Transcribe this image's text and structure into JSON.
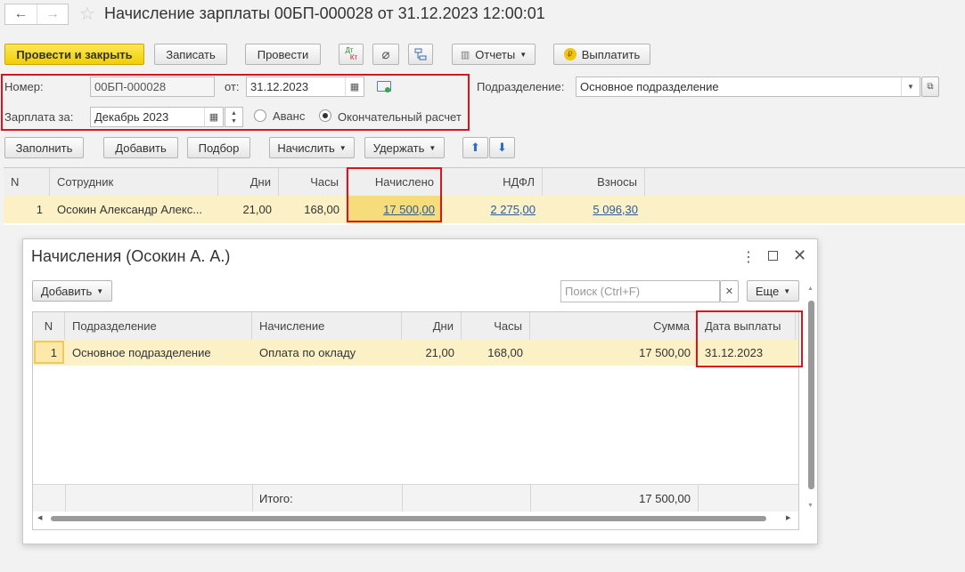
{
  "title": "Начисление зарплаты 00БП-000028 от 31.12.2023 12:00:01",
  "toolbar": {
    "post_close": "Провести и закрыть",
    "save": "Записать",
    "post": "Провести",
    "dtkt_top": "Дт",
    "dtkt_bottom": "Кт",
    "reports": "Отчеты",
    "pay": "Выплатить"
  },
  "header": {
    "number_label": "Номер:",
    "number_value": "00БП-000028",
    "date_label": "от:",
    "date_value": "31.12.2023",
    "dept_label": "Подразделение:",
    "dept_value": "Основное подразделение",
    "salary_label": "Зарплата за:",
    "salary_value": "Декабрь 2023",
    "radio_advance": "Аванс",
    "radio_final": "Окончательный расчет",
    "selected_radio": "final"
  },
  "actions": {
    "fill": "Заполнить",
    "add": "Добавить",
    "select": "Подбор",
    "accrue": "Начислить",
    "withhold": "Удержать"
  },
  "main_table": {
    "columns": [
      "N",
      "Сотрудник",
      "Дни",
      "Часы",
      "Начислено",
      "НДФЛ",
      "Взносы"
    ],
    "rows": [
      {
        "n": "1",
        "employee": "Осокин Александр Алекс...",
        "days": "21,00",
        "hours": "168,00",
        "accrued": "17 500,00",
        "ndfl": "2 275,00",
        "contrib": "5 096,30"
      }
    ]
  },
  "dialog": {
    "title": "Начисления (Осокин А. А.)",
    "add_label": "Добавить",
    "search_placeholder": "Поиск (Ctrl+F)",
    "more_label": "Еще",
    "columns": [
      "N",
      "Подразделение",
      "Начисление",
      "Дни",
      "Часы",
      "Сумма",
      "Дата выплаты"
    ],
    "rows": [
      {
        "n": "1",
        "dept": "Основное подразделение",
        "accrual": "Оплата по окладу",
        "days": "21,00",
        "hours": "168,00",
        "sum": "17 500,00",
        "pay_date": "31.12.2023"
      }
    ],
    "total_label": "Итого:",
    "total_sum": "17 500,00"
  },
  "colors": {
    "accent_yellow": "#f1cf00",
    "highlight_row": "#fbf0c6",
    "annotation_red": "#d9141f",
    "link": "#2a5aa0"
  }
}
